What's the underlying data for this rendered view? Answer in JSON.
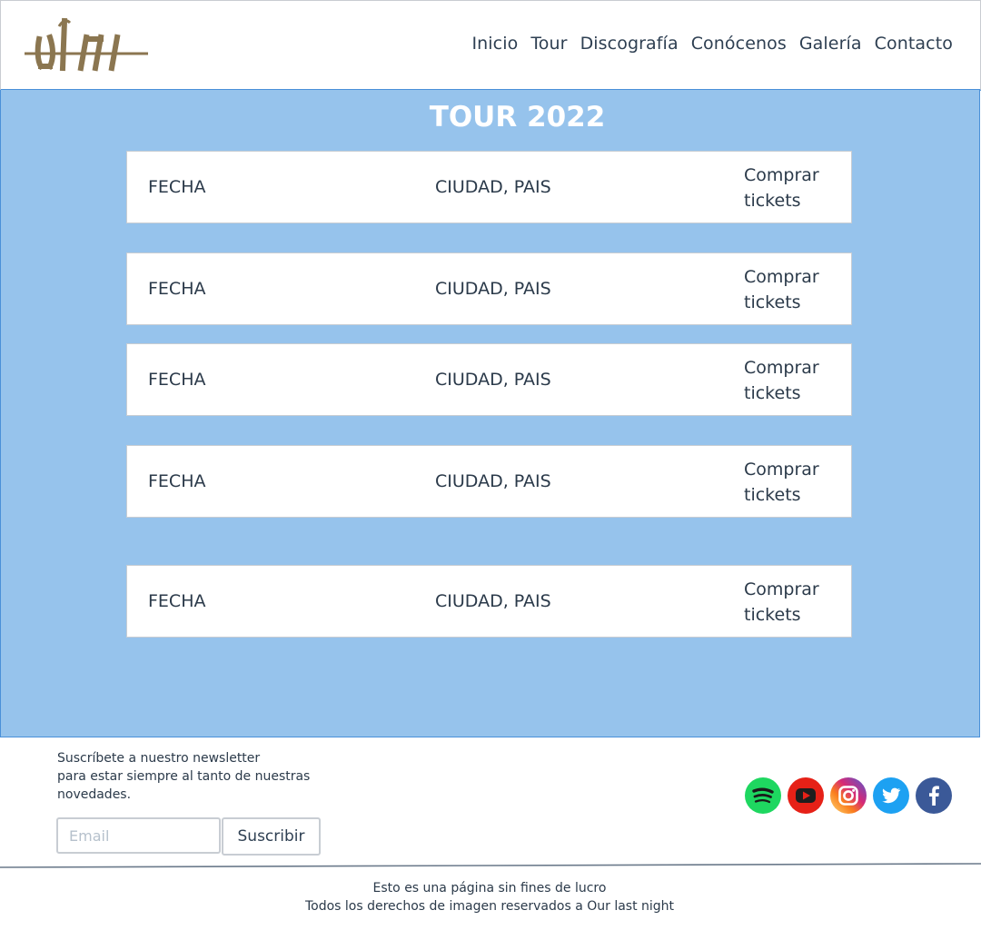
{
  "header": {
    "logo_icon": "band-logo-icon",
    "nav": [
      {
        "label": "Inicio"
      },
      {
        "label": "Tour"
      },
      {
        "label": "Discografía"
      },
      {
        "label": "Conócenos"
      },
      {
        "label": "Galería"
      },
      {
        "label": "Contacto"
      }
    ]
  },
  "main": {
    "title": "TOUR 2022",
    "background_color": "#96c3ec",
    "rows": [
      {
        "date": "FECHA",
        "location": "CIUDAD, PAIS",
        "action": "Comprar tickets"
      },
      {
        "date": "FECHA",
        "location": "CIUDAD, PAIS",
        "action": "Comprar tickets"
      },
      {
        "date": "FECHA",
        "location": "CIUDAD, PAIS",
        "action": "Comprar tickets"
      },
      {
        "date": "FECHA",
        "location": "CIUDAD, PAIS",
        "action": "Comprar tickets"
      },
      {
        "date": "FECHA",
        "location": "CIUDAD, PAIS",
        "action": "Comprar tickets"
      }
    ]
  },
  "footer": {
    "newsletter": {
      "line1": "Suscríbete a nuestro newsletter",
      "line2": "para estar siempre al tanto de nuestras novedades.",
      "email_placeholder": "Email",
      "email_value": "",
      "button_label": "Suscribir"
    },
    "social": [
      {
        "icon": "spotify-icon",
        "color": "#1ed760"
      },
      {
        "icon": "youtube-icon",
        "color": "#e62117"
      },
      {
        "icon": "instagram-icon",
        "color": "#c13584"
      },
      {
        "icon": "twitter-icon",
        "color": "#1da1f2"
      },
      {
        "icon": "facebook-icon",
        "color": "#3b5998"
      }
    ],
    "credits": {
      "line1": "Esto es una página  sin fines de lucro",
      "line2": "Todos los derechos de imagen reservados a Our last night"
    }
  }
}
